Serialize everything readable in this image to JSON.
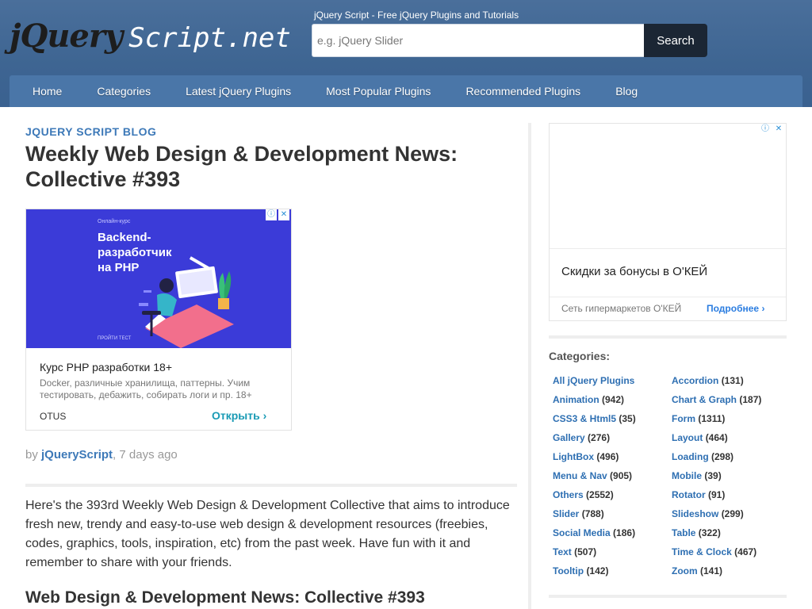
{
  "header": {
    "logo_jquery": "jQuery",
    "logo_script": "Script.net",
    "tagline": "jQuery Script - Free jQuery Plugins and Tutorials",
    "search_placeholder": "e.g. jQuery Slider",
    "search_button": "Search"
  },
  "nav": {
    "items": [
      {
        "label": "Home"
      },
      {
        "label": "Categories"
      },
      {
        "label": "Latest jQuery Plugins"
      },
      {
        "label": "Most Popular Plugins"
      },
      {
        "label": "Recommended Plugins"
      },
      {
        "label": "Blog"
      }
    ]
  },
  "article": {
    "section_label": "JQUERY SCRIPT BLOG",
    "title": "Weekly Web Design & Development News: Collective #393",
    "byline_prefix": "by",
    "author": "jQueryScript",
    "date": ", 7 days ago",
    "intro": "Here's the 393rd Weekly Web Design & Development Collective that aims to introduce fresh new, trendy and easy-to-use web design & development resources (freebies, codes, graphics, tools, inspiration, etc) from the past week. Have fun with it and remember to share with your friends.",
    "subheading": "Web Design & Development News: Collective #393"
  },
  "ad_main": {
    "banner_small": "Онлайн-курс",
    "banner_headline": "Backend-\nразработчик\nна PHP",
    "banner_cta": "ПРОЙТИ ТЕСТ",
    "title": "Курс PHP разработки 18+",
    "description": "Docker, различные хранилища, паттерны. Учим тестировать, дебажить, собирать логи и пр. 18+",
    "brand": "OTUS",
    "cta": "Открыть",
    "accent_color": "#3b3bd8"
  },
  "ad_side": {
    "title": "Скидки за бонусы в О'КЕЙ",
    "brand": "Сеть гипермаркетов О'КЕЙ",
    "more": "Подробнее"
  },
  "sidebar": {
    "categories_title": "Categories:",
    "categories": [
      {
        "name": "All jQuery Plugins",
        "count": ""
      },
      {
        "name": "Accordion",
        "count": "(131)"
      },
      {
        "name": "Animation",
        "count": "(942)"
      },
      {
        "name": "Chart & Graph",
        "count": "(187)"
      },
      {
        "name": "CSS3 & Html5",
        "count": "(35)"
      },
      {
        "name": "Form",
        "count": "(1311)"
      },
      {
        "name": "Gallery",
        "count": "(276)"
      },
      {
        "name": "Layout",
        "count": "(464)"
      },
      {
        "name": "LightBox",
        "count": "(496)"
      },
      {
        "name": "Loading",
        "count": "(298)"
      },
      {
        "name": "Menu & Nav",
        "count": "(905)"
      },
      {
        "name": "Mobile",
        "count": "(39)"
      },
      {
        "name": "Others",
        "count": "(2552)"
      },
      {
        "name": "Rotator",
        "count": "(91)"
      },
      {
        "name": "Slider",
        "count": "(788)"
      },
      {
        "name": "Slideshow",
        "count": "(299)"
      },
      {
        "name": "Social Media",
        "count": "(186)"
      },
      {
        "name": "Table",
        "count": "(322)"
      },
      {
        "name": "Text",
        "count": "(507)"
      },
      {
        "name": "Time & Clock",
        "count": "(467)"
      },
      {
        "name": "Tooltip",
        "count": "(142)"
      },
      {
        "name": "Zoom",
        "count": "(141)"
      }
    ]
  }
}
